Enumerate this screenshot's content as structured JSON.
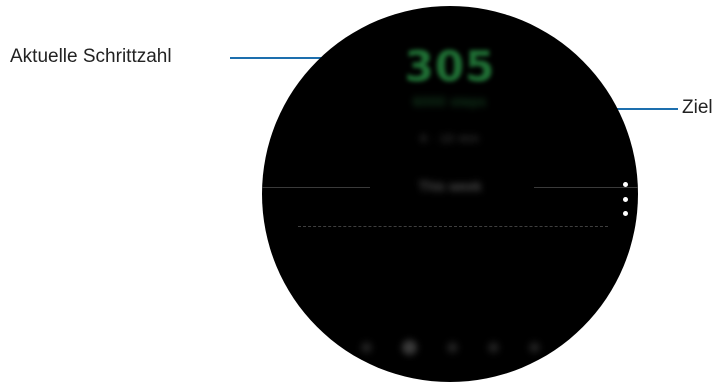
{
  "callouts": {
    "left_label": "Aktuelle Schrittzahl",
    "right_label": "Ziel"
  },
  "screen": {
    "step_count": "305",
    "goal_text": "6000 steps",
    "time_text": "6 · 10 min",
    "week_label": "This week"
  },
  "colors": {
    "callout_line": "#1d6fae",
    "step_green": "#1f6f34",
    "watch_bg": "#000000"
  },
  "icons": {
    "more": "more-vertical-icon"
  }
}
